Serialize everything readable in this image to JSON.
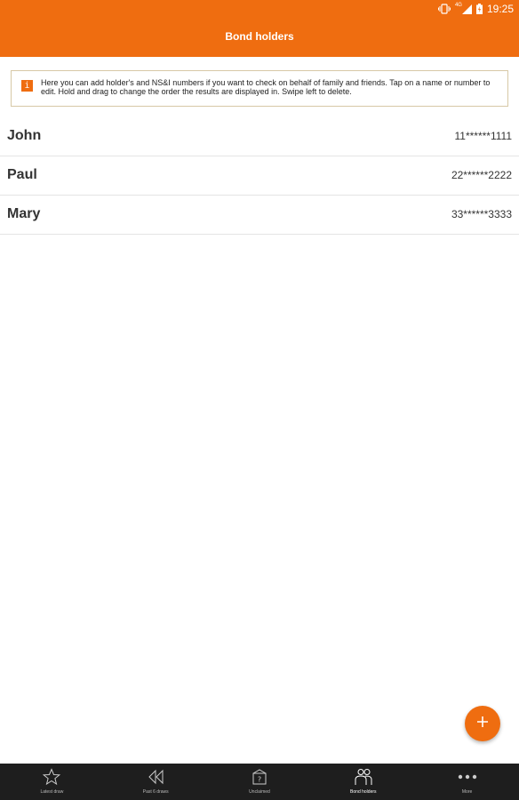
{
  "status_bar": {
    "network": "4G",
    "time": "19:25"
  },
  "header": {
    "title": "Bond holders",
    "color": "#ef6d10"
  },
  "info": {
    "icon": "info-icon",
    "icon_glyph": "i",
    "text": "Here you can add holder's and NS&I numbers if you want to check on behalf of family and friends. Tap on a name or number to edit. Hold and drag to change the order the results are displayed in. Swipe left to delete."
  },
  "holders": [
    {
      "name": "John",
      "number": "11******1111"
    },
    {
      "name": "Paul",
      "number": "22******2222"
    },
    {
      "name": "Mary",
      "number": "33******3333"
    }
  ],
  "fab": {
    "icon": "plus-icon"
  },
  "nav": {
    "items": [
      {
        "label": "Latest draw",
        "icon": "star-icon"
      },
      {
        "label": "Past 6 draws",
        "icon": "rewind-icon"
      },
      {
        "label": "Unclaimed",
        "icon": "gift-icon"
      },
      {
        "label": "Bond holders",
        "icon": "people-icon",
        "active": true
      },
      {
        "label": "More",
        "icon": "more-icon"
      }
    ]
  }
}
